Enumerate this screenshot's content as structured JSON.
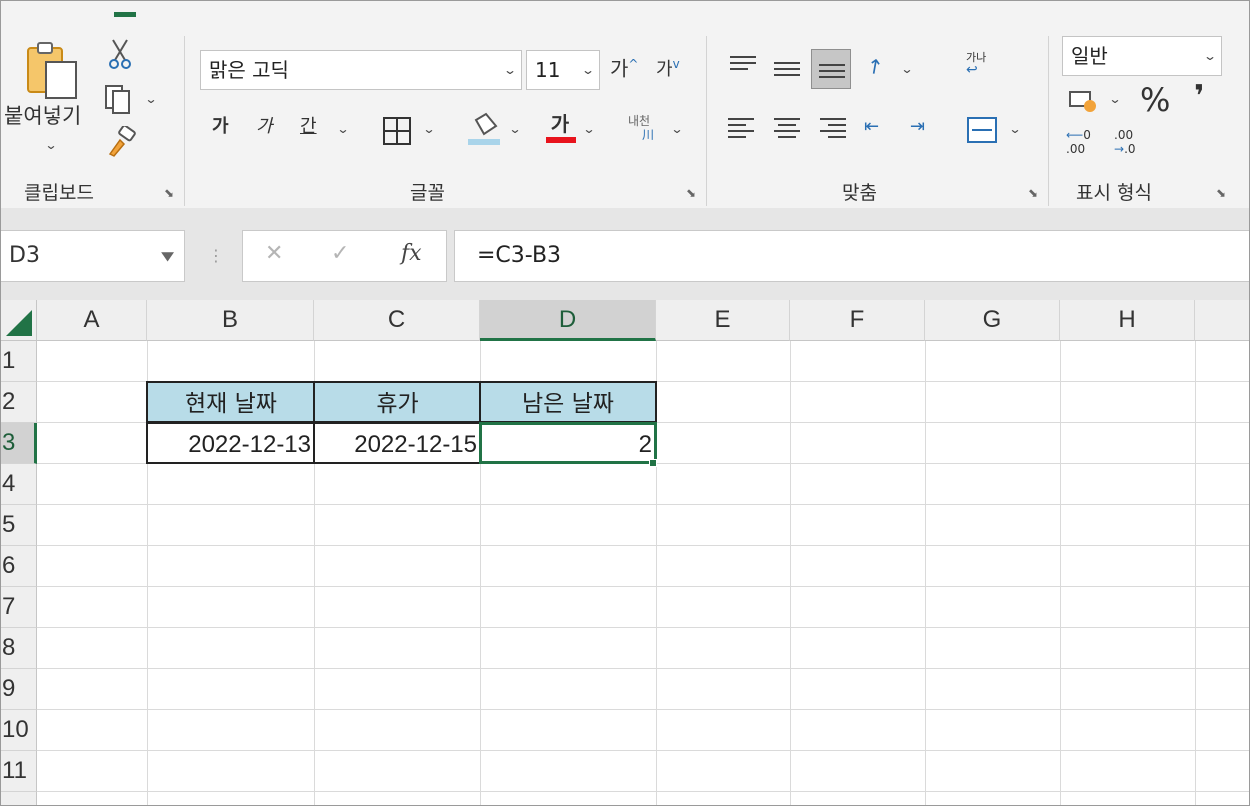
{
  "ribbon": {
    "clipboard": {
      "paste_label": "붙여넣기",
      "group_label": "클립보드",
      "icons": [
        "paste-icon",
        "cut-icon",
        "copy-icon",
        "format-painter-icon"
      ]
    },
    "font": {
      "font_name": "맑은 고딕",
      "font_size": "11",
      "grow_font": "가",
      "shrink_font": "가",
      "bold": "가",
      "italic": "가",
      "underline": "간",
      "font_color": "가",
      "phonetic": "내천",
      "group_label": "글꼴"
    },
    "alignment": {
      "wrap_text": "가나",
      "group_label": "맞춤"
    },
    "number": {
      "format": "일반",
      "percent": "%",
      "comma": "❜",
      "increase_decimal": ".00",
      "decrease_decimal": ".00",
      "group_label": "표시 형식"
    }
  },
  "formula_bar": {
    "name_box": "D3",
    "cancel_symbol": "✕",
    "enter_symbol": "✓",
    "fx_symbol": "fx",
    "formula": "=C3-B3"
  },
  "sheet": {
    "columns": [
      "A",
      "B",
      "C",
      "D",
      "E",
      "F",
      "G",
      "H"
    ],
    "rows": [
      "1",
      "2",
      "3",
      "4",
      "5",
      "6",
      "7",
      "8",
      "9",
      "10",
      "11"
    ],
    "active_cell": "D3",
    "table": {
      "headers": [
        "현재 날짜",
        "휴가",
        "남은 날짜"
      ],
      "values": [
        "2022-12-13",
        "2022-12-15",
        "2"
      ]
    },
    "header_fill": "#b8dce8",
    "accent": "#217346"
  }
}
